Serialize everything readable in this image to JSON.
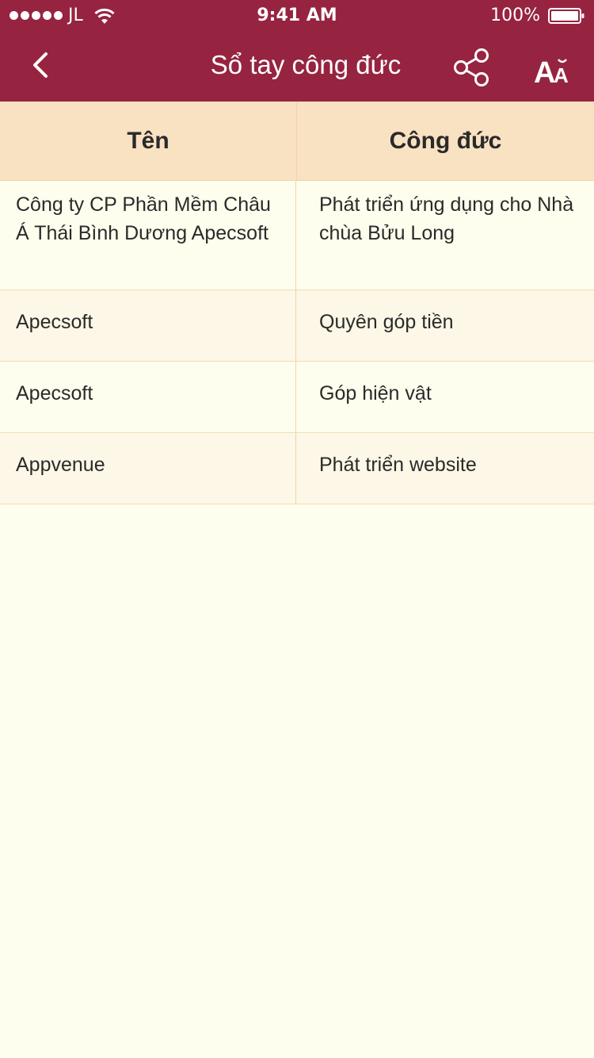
{
  "status_bar": {
    "carrier": "JL",
    "time": "9:41 AM",
    "battery": "100%"
  },
  "nav": {
    "title": "Sổ tay công đức",
    "font_button_label": "AA"
  },
  "table": {
    "headers": [
      "Tên",
      "Công đức"
    ],
    "rows": [
      {
        "name": "Công ty CP Phần Mềm Châu Á Thái Bình Dương Apecsoft",
        "merit": "Phát triển ứng dụng cho Nhà chùa Bửu Long"
      },
      {
        "name": "Apecsoft",
        "merit": "Quyên góp tiền"
      },
      {
        "name": "Apecsoft",
        "merit": "Góp hiện vật"
      },
      {
        "name": "Appvenue",
        "merit": "Phát triển website"
      }
    ]
  },
  "colors": {
    "header_bg": "#962440",
    "table_header_bg": "#F8E2C2",
    "page_bg": "#FEFEEE",
    "alt_row_bg": "#FCF7E6"
  }
}
